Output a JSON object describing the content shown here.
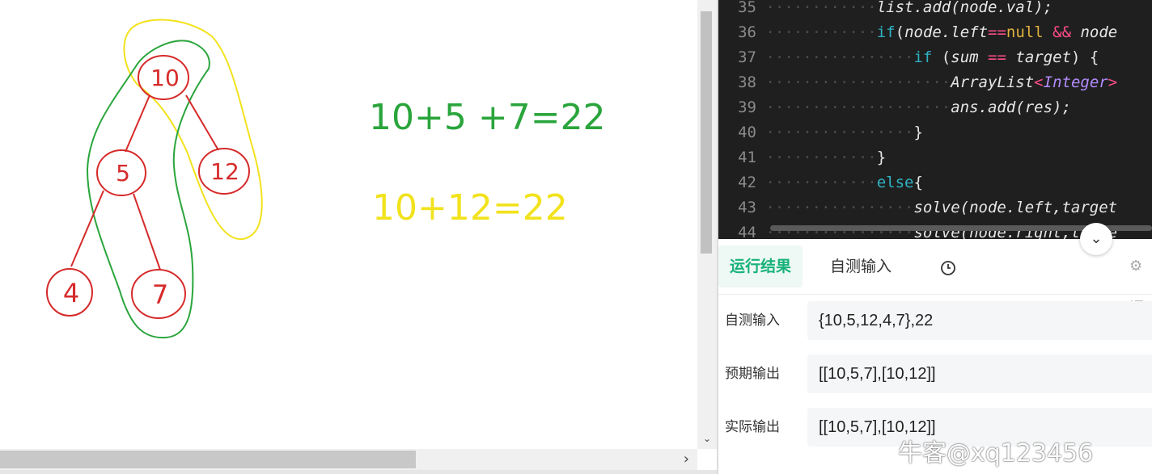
{
  "canvas": {
    "tree": {
      "nodes": [
        "10",
        "5",
        "12",
        "4",
        "7"
      ]
    },
    "equations": {
      "green": "10+5 +7=22",
      "yellow": "10+12=22"
    },
    "colors": {
      "tree": "#d62a2a",
      "green_path": "#2aa53c",
      "yellow_path": "#f2e21c"
    }
  },
  "editor": {
    "lines": [
      {
        "num": "35",
        "indent": "············",
        "tokens": [
          [
            "id",
            "list.add(node.val);"
          ]
        ]
      },
      {
        "num": "36",
        "indent": "············",
        "tokens": [
          [
            "kw",
            "if"
          ],
          [
            "p",
            "("
          ],
          [
            "id",
            "node.left"
          ],
          [
            "op",
            "=="
          ],
          [
            "null",
            "null"
          ],
          [
            "p",
            " "
          ],
          [
            "op",
            "&&"
          ],
          [
            "p",
            " "
          ],
          [
            "id",
            "node"
          ]
        ]
      },
      {
        "num": "37",
        "indent": "················",
        "tokens": [
          [
            "kw",
            "if"
          ],
          [
            "p",
            " ("
          ],
          [
            "id",
            "sum"
          ],
          [
            "p",
            " "
          ],
          [
            "op",
            "=="
          ],
          [
            "p",
            " "
          ],
          [
            "id",
            "target"
          ],
          [
            "p",
            ") {"
          ]
        ]
      },
      {
        "num": "38",
        "indent": "····················",
        "tokens": [
          [
            "id",
            "ArrayList"
          ],
          [
            "op",
            "<"
          ],
          [
            "type",
            "Integer"
          ],
          [
            "op",
            ">"
          ]
        ]
      },
      {
        "num": "39",
        "indent": "····················",
        "tokens": [
          [
            "id",
            "ans.add(res);"
          ]
        ]
      },
      {
        "num": "40",
        "indent": "················",
        "tokens": [
          [
            "p",
            "}"
          ]
        ]
      },
      {
        "num": "41",
        "indent": "············",
        "tokens": [
          [
            "p",
            "}"
          ]
        ]
      },
      {
        "num": "42",
        "indent": "············",
        "tokens": [
          [
            "kw",
            "else"
          ],
          [
            "p",
            "{"
          ]
        ]
      },
      {
        "num": "43",
        "indent": "················",
        "tokens": [
          [
            "id",
            "solve(node.left,target"
          ]
        ]
      },
      {
        "num": "44",
        "indent": "················",
        "tokens": [
          [
            "id",
            "solve(node.right,targe"
          ]
        ]
      }
    ]
  },
  "results": {
    "tabs": {
      "result": "运行结果",
      "selftest": "自测输入",
      "history_icon": "clock-icon",
      "debug": "⚙调"
    },
    "rows": [
      {
        "label": "自测输入",
        "value": "{10,5,12,4,7},22"
      },
      {
        "label": "预期输出",
        "value": "[[10,5,7],[10,12]]"
      },
      {
        "label": "实际输出",
        "value": "[[10,5,7],[10,12]]"
      }
    ],
    "accent": "#17b27a"
  },
  "watermark": "牛客@xq123456"
}
